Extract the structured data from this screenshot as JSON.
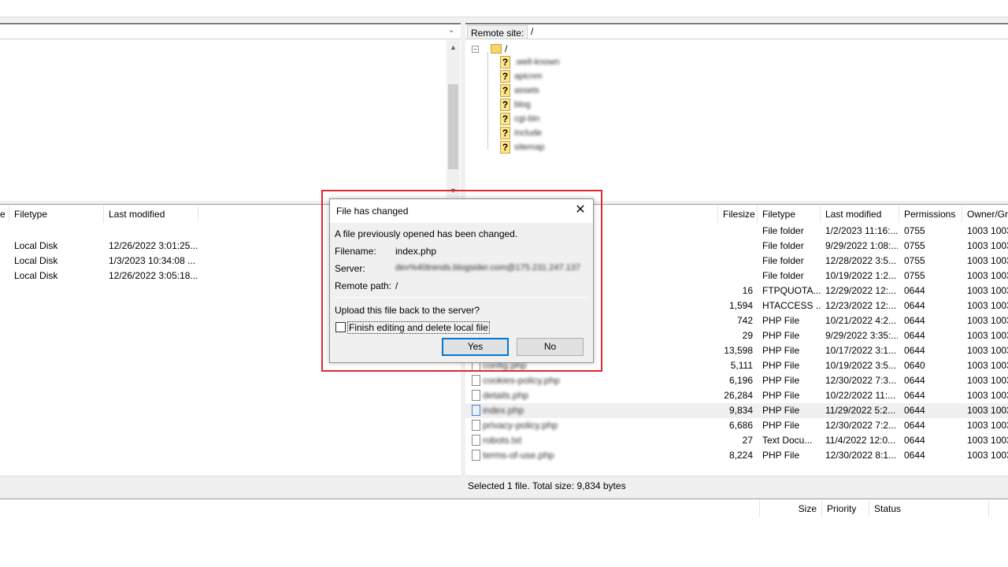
{
  "remote_site": {
    "label": "Remote site:",
    "path": "/"
  },
  "remote_tree": {
    "root": "/",
    "items": [
      ".well-known",
      "apicnm",
      "assets",
      "blog",
      "cgi-bin",
      "include",
      "sitemap"
    ]
  },
  "local_list": {
    "columns": [
      "e",
      "Filetype",
      "Last modified"
    ],
    "rows": [
      {
        "filetype": "Local Disk",
        "modified": "12/26/2022 3:01:25..."
      },
      {
        "filetype": "Local Disk",
        "modified": "1/3/2023 10:34:08 ..."
      },
      {
        "filetype": "Local Disk",
        "modified": "12/26/2022 3:05:18..."
      }
    ]
  },
  "remote_list": {
    "columns": [
      "Filesize",
      "Filetype",
      "Last modified",
      "Permissions",
      "Owner/Gr"
    ],
    "rows": [
      {
        "name": "",
        "size": "",
        "type": "File folder",
        "modified": "1/2/2023 11:16:...",
        "perms": "0755",
        "owner": "1003 1003"
      },
      {
        "name": "",
        "size": "",
        "type": "File folder",
        "modified": "9/29/2022 1:08:...",
        "perms": "0755",
        "owner": "1003 1003"
      },
      {
        "name": "",
        "size": "",
        "type": "File folder",
        "modified": "12/28/2022 3:5...",
        "perms": "0755",
        "owner": "1003 1003"
      },
      {
        "name": "",
        "size": "",
        "type": "File folder",
        "modified": "10/19/2022 1:2...",
        "perms": "0755",
        "owner": "1003 1003"
      },
      {
        "name": "",
        "size": "16",
        "type": "FTPQUOTA...",
        "modified": "12/29/2022 12:...",
        "perms": "0644",
        "owner": "1003 1003"
      },
      {
        "name": "",
        "size": "1,594",
        "type": "HTACCESS ...",
        "modified": "12/23/2022 12:...",
        "perms": "0644",
        "owner": "1003 1003"
      },
      {
        "name": "",
        "size": "742",
        "type": "PHP File",
        "modified": "10/21/2022 4:2...",
        "perms": "0644",
        "owner": "1003 1003"
      },
      {
        "name": "",
        "size": "29",
        "type": "PHP File",
        "modified": "9/29/2022 3:35:...",
        "perms": "0644",
        "owner": "1003 1003"
      },
      {
        "name": "",
        "size": "13,598",
        "type": "PHP File",
        "modified": "10/17/2022 3:1...",
        "perms": "0644",
        "owner": "1003 1003"
      },
      {
        "name": "config.php",
        "size": "5,111",
        "type": "PHP File",
        "modified": "10/19/2022 3:5...",
        "perms": "0640",
        "owner": "1003 1003"
      },
      {
        "name": "cookies-policy.php",
        "size": "6,196",
        "type": "PHP File",
        "modified": "12/30/2022 7:3...",
        "perms": "0644",
        "owner": "1003 1003"
      },
      {
        "name": "details.php",
        "size": "26,284",
        "type": "PHP File",
        "modified": "10/22/2022 11:...",
        "perms": "0644",
        "owner": "1003 1003"
      },
      {
        "name": "index.php",
        "size": "9,834",
        "type": "PHP File",
        "modified": "11/29/2022 5:2...",
        "perms": "0644",
        "owner": "1003 1003"
      },
      {
        "name": "privacy-policy.php",
        "size": "6,686",
        "type": "PHP File",
        "modified": "12/30/2022 7:2...",
        "perms": "0644",
        "owner": "1003 1003"
      },
      {
        "name": "robots.txt",
        "size": "27",
        "type": "Text Docu...",
        "modified": "11/4/2022 12:0...",
        "perms": "0644",
        "owner": "1003 1003"
      },
      {
        "name": "terms-of-use.php",
        "size": "8,224",
        "type": "PHP File",
        "modified": "12/30/2022 8:1...",
        "perms": "0644",
        "owner": "1003 1003"
      }
    ]
  },
  "status_right": "Selected 1 file. Total size: 9,834 bytes",
  "queue_columns": [
    "Size",
    "Priority",
    "Status"
  ],
  "dialog": {
    "title": "File has changed",
    "message": "A file previously opened has been changed.",
    "filename_label": "Filename:",
    "filename": "index.php",
    "server_label": "Server:",
    "server": "dev%40trends.blogsider.com@175.231.247.137",
    "remote_path_label": "Remote path:",
    "remote_path": "/",
    "question": "Upload this file back to the server?",
    "checkbox_label": "Finish editing and delete local file",
    "yes": "Yes",
    "no": "No"
  }
}
